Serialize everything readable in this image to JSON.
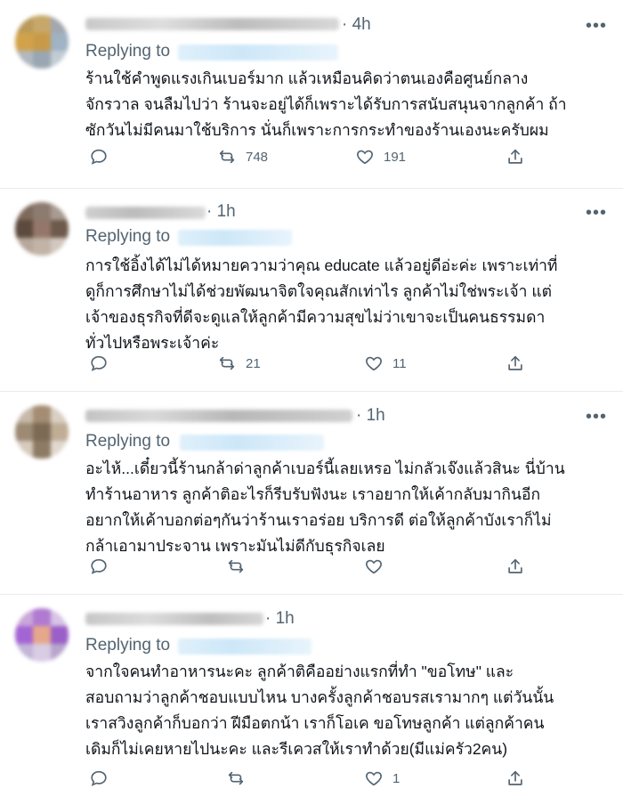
{
  "tweets": [
    {
      "time": "4h",
      "replying_label": "Replying to",
      "lines": [
        "ร้านใช้คำพูดแรงเกินเบอร์มาก แล้วเหมือนคิดว่าตนเองคือศูนย์กลาง",
        "จักรวาล จนลืมไปว่า ร้านจะอยู่ได้ก็เพราะได้รับการสนับสนุนจากลูกค้า ถ้า",
        "ซักวันไม่มีคนมาใช้บริการ นั่นก็เพราะการกระทำของร้านเองนะครับผม"
      ],
      "retweets": "748",
      "likes": "191"
    },
    {
      "time": "1h",
      "replying_label": "Replying to",
      "lines": [
        "การใช้อิ้งได้ไม่ได้หมายความว่าคุณ educate แล้วอยู่ดีอ่ะค่ะ เพราะเท่าที่",
        "ดูก็การศึกษาไม่ได้ช่วยพัฒนาจิตใจคุณสักเท่าไร ลูกค้าไม่ใช่พระเจ้า แต่",
        "เจ้าของธุรกิจที่ดีจะดูแลให้ลูกค้ามีความสุขไม่ว่าเขาจะเป็นคนธรรมดา",
        "ทั่วไปหรือพระเจ้าค่ะ"
      ],
      "retweets": "21",
      "likes": "11"
    },
    {
      "time": "1h",
      "replying_label": "Replying to",
      "lines": [
        "อะไห้...เดี๋ยวนี้ร้านกล้าด่าลูกค้าเบอร์นี้เลยเหรอ ไม่กลัวเจ๊งแล้วสินะ นี่บ้าน",
        "ทำร้านอาหาร ลูกค้าติอะไรก็รีบรับฟังนะ เราอยากให้เค้ากลับมากินอีก",
        "อยากให้เค้าบอกต่อๆกันว่าร้านเราอร่อย บริการดี ต่อให้ลูกค้าบังเราก็ไม่",
        "กล้าเอามาประจาน เพราะมันไม่ดีกับธุรกิจเลย"
      ],
      "retweets": "",
      "likes": ""
    },
    {
      "time": "1h",
      "replying_label": "Replying to",
      "lines": [
        "จากใจคนทำอาหารนะคะ ลูกค้าติคืออย่างแรกที่ทำ \"ขอโทษ\" และ",
        "สอบถามว่าลูกค้าชอบแบบไหน  บางครั้งลูกค้าชอบรสเรามากๆ แต่วันนั้น",
        "เราสวิงลูกค้าก็บอกว่า ฝีมือตกน้า เราก็โอเค ขอโทษลูกค้า แต่ลูกค้าคน",
        "เดิมก็ไม่เคยหายไปนะคะ และรีเควสให้เราทำด้วย(มีแม่ครัว2คน)"
      ],
      "retweets": "",
      "likes": "1"
    }
  ],
  "more_glyph": "•••",
  "colors": {
    "text": "#0f1419",
    "muted": "#536471",
    "divider": "#e6ecf0"
  }
}
